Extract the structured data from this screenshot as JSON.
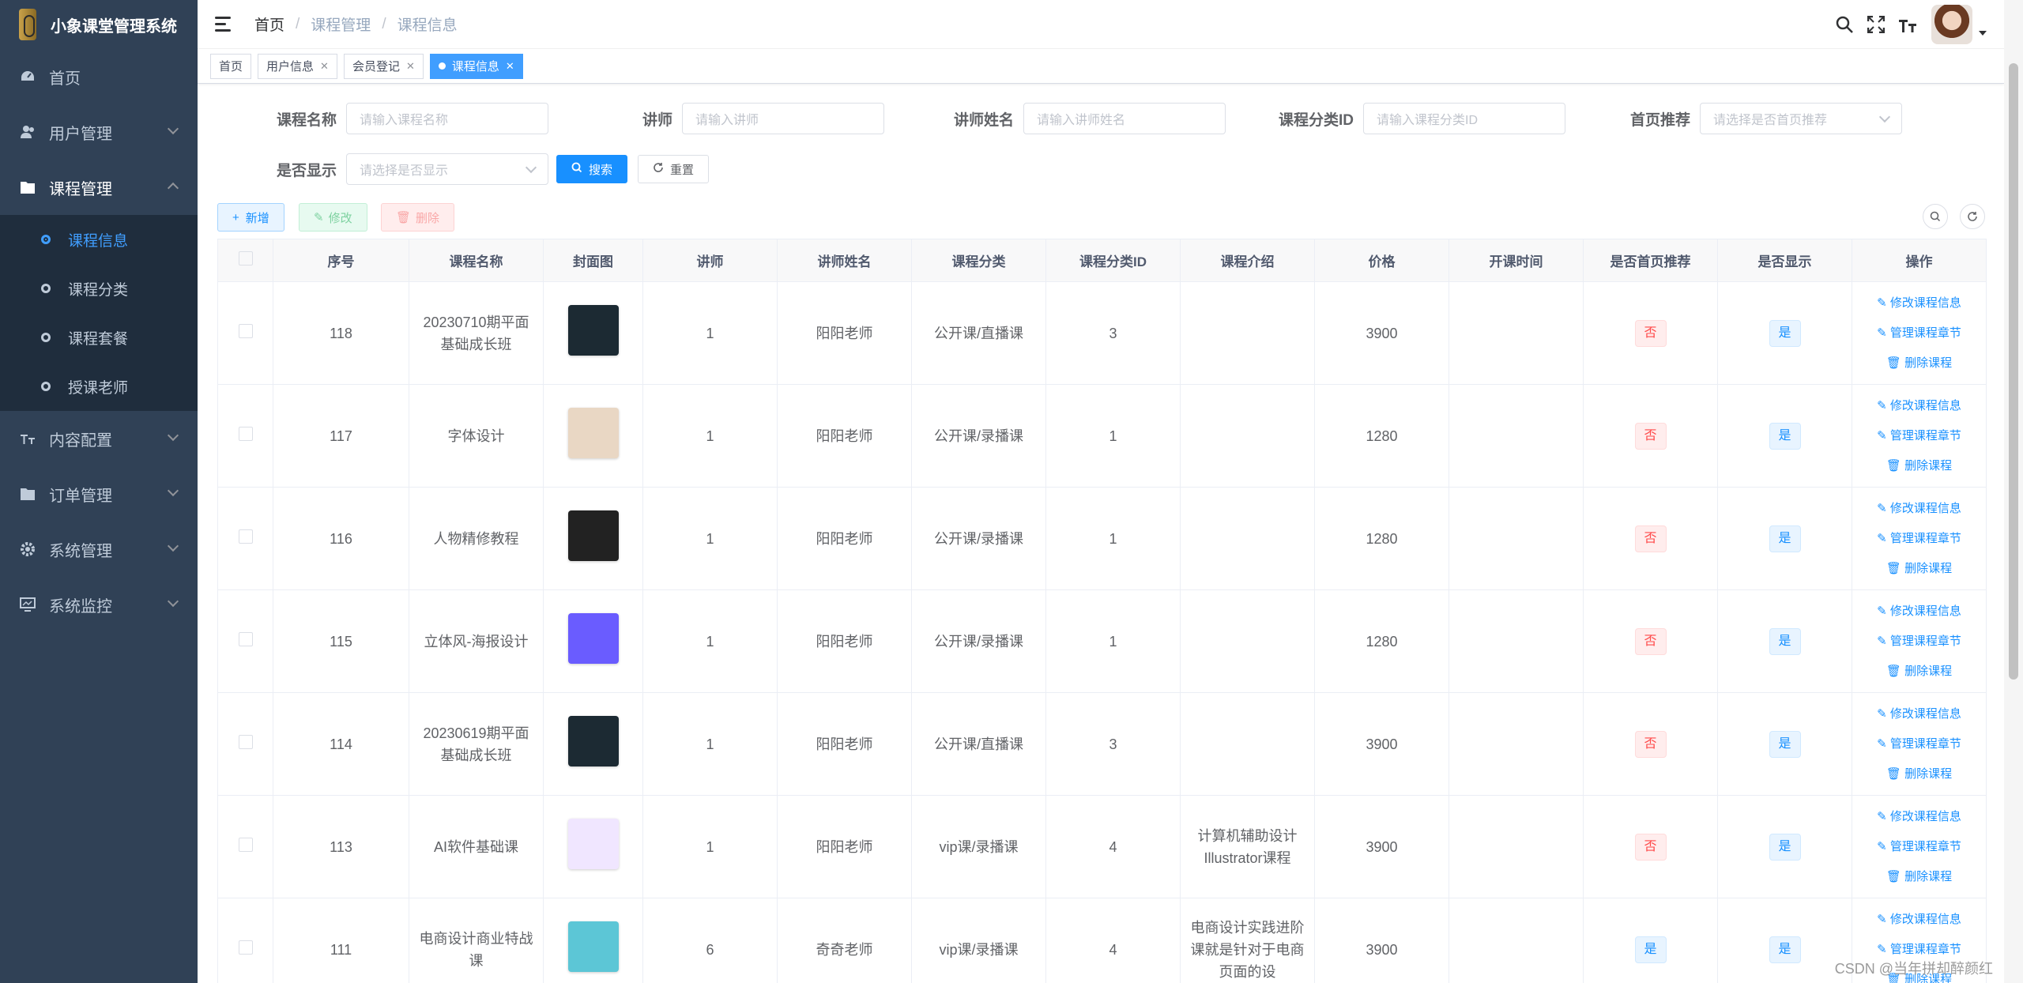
{
  "app": {
    "title": "小象课堂管理系统"
  },
  "sidebar": {
    "items": [
      {
        "label": "首页",
        "icon": "dashboard-icon"
      },
      {
        "label": "用户管理",
        "icon": "user-icon"
      },
      {
        "label": "课程管理",
        "icon": "folder-icon"
      },
      {
        "label": "内容配置",
        "icon": "text-size-icon"
      },
      {
        "label": "订单管理",
        "icon": "folder-icon"
      },
      {
        "label": "系统管理",
        "icon": "gear-icon"
      },
      {
        "label": "系统监控",
        "icon": "monitor-icon"
      }
    ],
    "submenu": [
      {
        "label": "课程信息"
      },
      {
        "label": "课程分类"
      },
      {
        "label": "课程套餐"
      },
      {
        "label": "授课老师"
      }
    ]
  },
  "breadcrumb": [
    "首页",
    "课程管理",
    "课程信息"
  ],
  "tags": [
    "首页",
    "用户信息",
    "会员登记",
    "课程信息"
  ],
  "search": {
    "course_name": {
      "label": "课程名称",
      "placeholder": "请输入课程名称"
    },
    "teacher": {
      "label": "讲师",
      "placeholder": "请输入讲师"
    },
    "teacher_name": {
      "label": "讲师姓名",
      "placeholder": "请输入讲师姓名"
    },
    "category_id": {
      "label": "课程分类ID",
      "placeholder": "请输入课程分类ID"
    },
    "homepage": {
      "label": "首页推荐",
      "placeholder": "请选择是否首页推荐"
    },
    "display": {
      "label": "是否显示",
      "placeholder": "请选择是否显示"
    },
    "search_btn": "搜索",
    "reset_btn": "重置"
  },
  "toolbar": {
    "add": "新增",
    "edit": "修改",
    "delete": "删除"
  },
  "table": {
    "headers": [
      "序号",
      "课程名称",
      "封面图",
      "讲师",
      "讲师姓名",
      "课程分类",
      "课程分类ID",
      "课程介绍",
      "价格",
      "开课时间",
      "是否首页推荐",
      "是否显示",
      "操作"
    ],
    "ops": [
      "修改课程信息",
      "管理课程章节",
      "删除课程"
    ],
    "rows": [
      {
        "id": "118",
        "name": "20230710期平面基础成长班",
        "teacher": "1",
        "teacher_name": "阳阳老师",
        "category": "公开课/直播课",
        "category_id": "3",
        "intro": "",
        "price": "3900",
        "start": "",
        "homepage": "否",
        "display": "是",
        "cover_color": "#1c2a33"
      },
      {
        "id": "117",
        "name": "字体设计",
        "teacher": "1",
        "teacher_name": "阳阳老师",
        "category": "公开课/录播课",
        "category_id": "1",
        "intro": "",
        "price": "1280",
        "start": "",
        "homepage": "否",
        "display": "是",
        "cover_color": "#e9d7c4"
      },
      {
        "id": "116",
        "name": "人物精修教程",
        "teacher": "1",
        "teacher_name": "阳阳老师",
        "category": "公开课/录播课",
        "category_id": "1",
        "intro": "",
        "price": "1280",
        "start": "",
        "homepage": "否",
        "display": "是",
        "cover_color": "#222222"
      },
      {
        "id": "115",
        "name": "立体风-海报设计",
        "teacher": "1",
        "teacher_name": "阳阳老师",
        "category": "公开课/录播课",
        "category_id": "1",
        "intro": "",
        "price": "1280",
        "start": "",
        "homepage": "否",
        "display": "是",
        "cover_color": "#6a5cff"
      },
      {
        "id": "114",
        "name": "20230619期平面基础成长班",
        "teacher": "1",
        "teacher_name": "阳阳老师",
        "category": "公开课/直播课",
        "category_id": "3",
        "intro": "",
        "price": "3900",
        "start": "",
        "homepage": "否",
        "display": "是",
        "cover_color": "#1c2a33"
      },
      {
        "id": "113",
        "name": "AI软件基础课",
        "teacher": "1",
        "teacher_name": "阳阳老师",
        "category": "vip课/录播课",
        "category_id": "4",
        "intro": "计算机辅助设计Illustrator课程",
        "price": "3900",
        "start": "",
        "homepage": "否",
        "display": "是",
        "cover_color": "#f0e6ff"
      },
      {
        "id": "111",
        "name": "电商设计商业特战课",
        "teacher": "6",
        "teacher_name": "奇奇老师",
        "category": "vip课/录播课",
        "category_id": "4",
        "intro": "电商设计实践进阶课就是针对于电商页面的设",
        "price": "3900",
        "start": "",
        "homepage": "是",
        "display": "是",
        "cover_color": "#5cc6d6"
      }
    ]
  },
  "watermark": "CSDN @当年拼却醉颜红"
}
